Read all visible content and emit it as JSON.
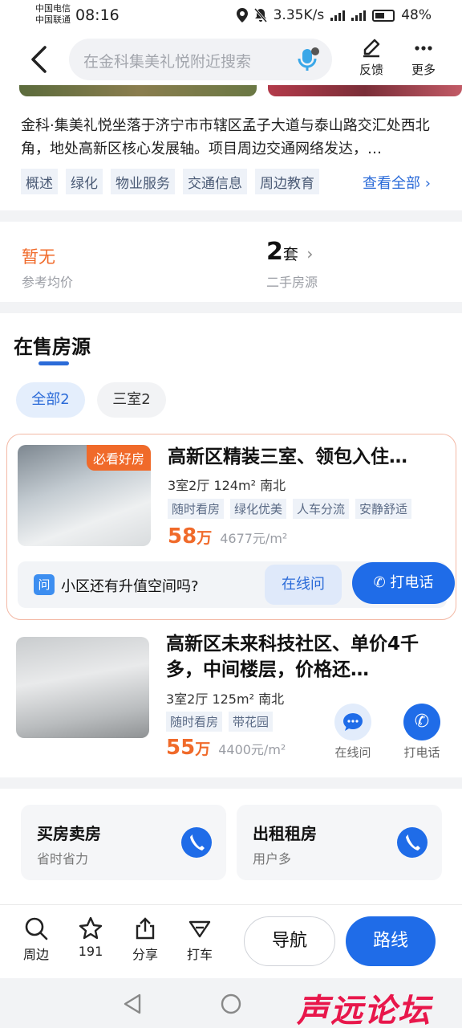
{
  "status_bar": {
    "carrier1": "中国电信",
    "carrier2": "中国联通",
    "time": "08:16",
    "net_speed": "3.35K/s",
    "battery": "48%"
  },
  "header": {
    "search_placeholder": "在金科集美礼悦附近搜索",
    "feedback_label": "反馈",
    "more_label": "更多"
  },
  "intro": {
    "description": "金科·集美礼悦坐落于济宁市市辖区孟子大道与泰山路交汇处西北角，地处高新区核心发展轴。项目周边交通网络发达，…",
    "tags": [
      "概述",
      "绿化",
      "物业服务",
      "交通信息",
      "周边教育"
    ],
    "see_all": "查看全部"
  },
  "price_stats": {
    "ref_price_value": "暂无",
    "ref_price_label": "参考均价",
    "second_hand_count": "2",
    "second_hand_unit": "套",
    "second_hand_label": "二手房源"
  },
  "listings": {
    "section_title": "在售房源",
    "filters": [
      "全部2",
      "三室2"
    ],
    "items": [
      {
        "badge": "必看好房",
        "title": "高新区精装三室、领包入住…",
        "spec": "3室2厅 124m² 南北",
        "tags": [
          "随时看房",
          "绿化优美",
          "人车分流",
          "安静舒适"
        ],
        "price": "58",
        "price_unit": "万",
        "unit_price": "4677元/m²",
        "question": "小区还有升值空间吗?",
        "ask_label": "在线问",
        "call_label": "打电话",
        "q_icon": "问"
      },
      {
        "title": "高新区未来科技社区、单价4千多，中间楼层，价格还…",
        "spec": "3室2厅 125m² 南北",
        "tags": [
          "随时看房",
          "带花园"
        ],
        "price": "55",
        "price_unit": "万",
        "unit_price": "4400元/m²",
        "ask_label": "在线问",
        "call_label": "打电话"
      }
    ]
  },
  "services": [
    {
      "title": "买房卖房",
      "subtitle": "省时省力"
    },
    {
      "title": "出租租房",
      "subtitle": "用户多"
    }
  ],
  "bottom_bar": {
    "nearby": "周边",
    "favorites": "191",
    "share": "分享",
    "taxi": "打车",
    "navigate": "导航",
    "route": "路线"
  },
  "watermark": "声远论坛",
  "colors": {
    "accent": "#1f6ce8",
    "price": "#f06a2a"
  }
}
